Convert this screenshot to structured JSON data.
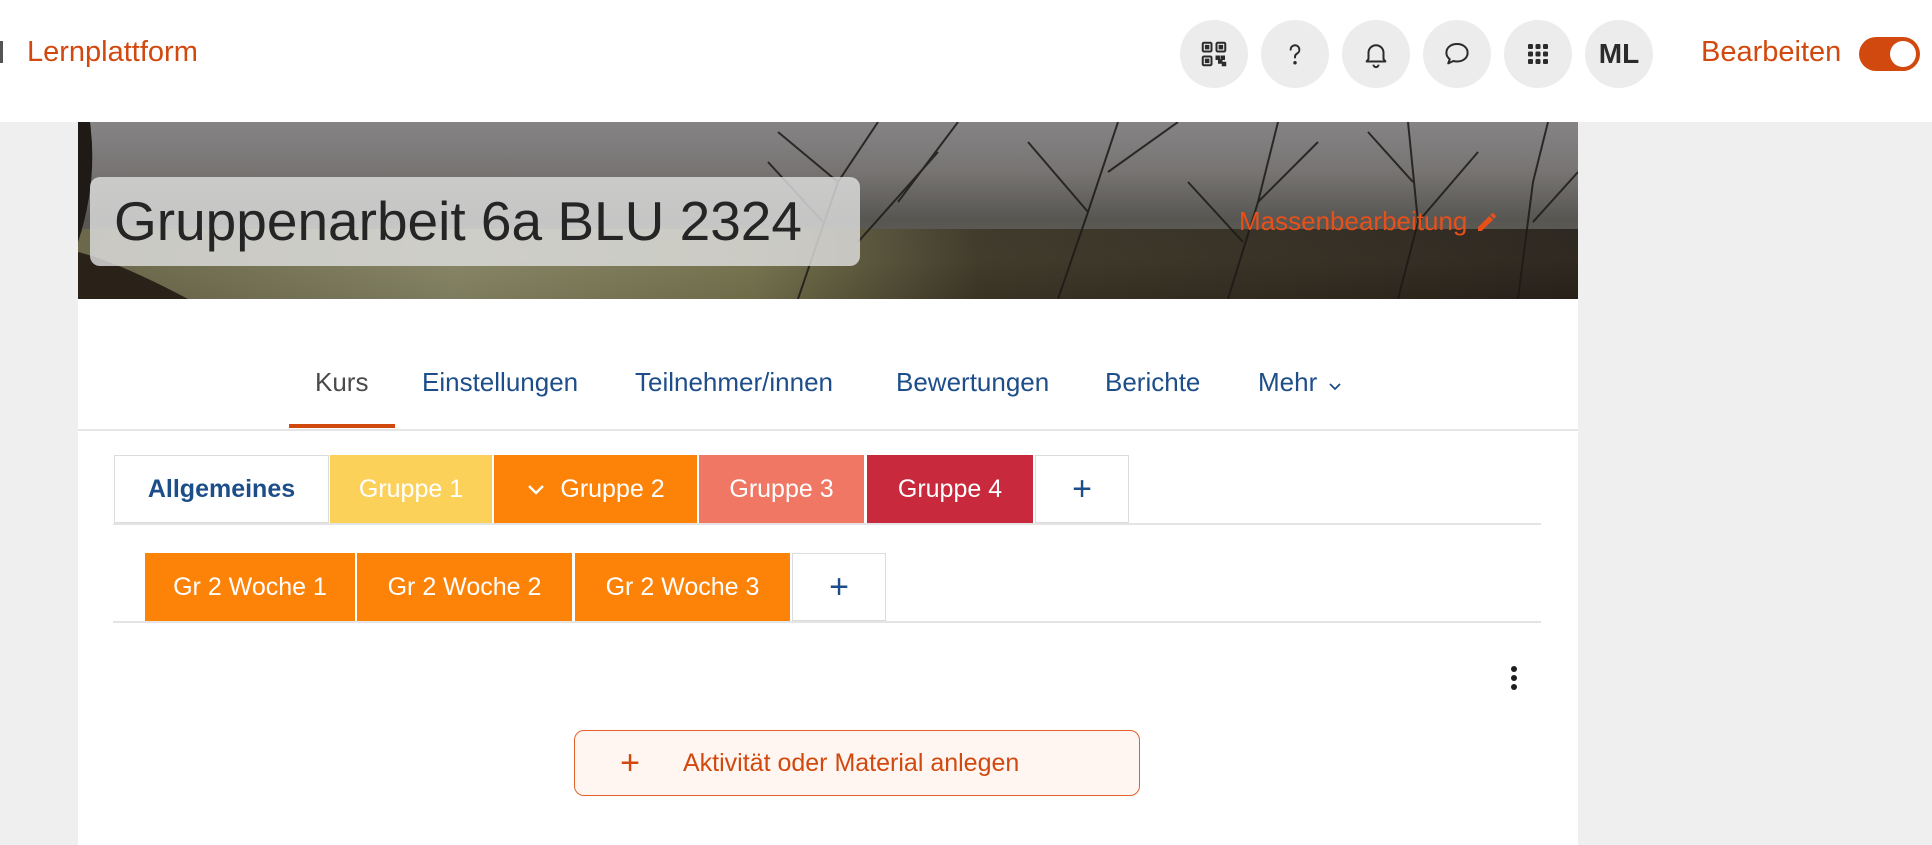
{
  "navbar": {
    "brand": "Lernplattform",
    "icons": [
      "qr-code-icon",
      "help-icon",
      "bell-icon",
      "chat-icon",
      "apps-grid-icon"
    ],
    "avatar_initials": "ML",
    "edit_mode_label": "Bearbeiten",
    "edit_mode_on": true,
    "accent_color": "#d1490e"
  },
  "course": {
    "title": "Gruppenarbeit 6a BLU 2324",
    "bulk_edit_label": "Massenbearbeitung"
  },
  "secondary_nav": {
    "items": [
      "Kurs",
      "Einstellungen",
      "Teilnehmer/innen",
      "Bewertungen",
      "Berichte",
      "Mehr"
    ],
    "active": "Kurs"
  },
  "section_tabs": {
    "level1": [
      {
        "label": "Allgemeines",
        "color": "#ffffff"
      },
      {
        "label": "Gruppe 1",
        "color": "#fcd15a"
      },
      {
        "label": "Gruppe 2",
        "color": "#fd8208",
        "expanded": true
      },
      {
        "label": "Gruppe 3",
        "color": "#f07763"
      },
      {
        "label": "Gruppe 4",
        "color": "#c8293c"
      }
    ],
    "add_label": "+",
    "level2": [
      {
        "label": "Gr 2 Woche 1",
        "color": "#fd8208"
      },
      {
        "label": "Gr 2 Woche 2",
        "color": "#fd8208"
      },
      {
        "label": "Gr 2 Woche 3",
        "color": "#fd8208"
      }
    ]
  },
  "content": {
    "add_activity_label": "Aktivität oder Material anlegen",
    "add_activity_plus": "+"
  }
}
